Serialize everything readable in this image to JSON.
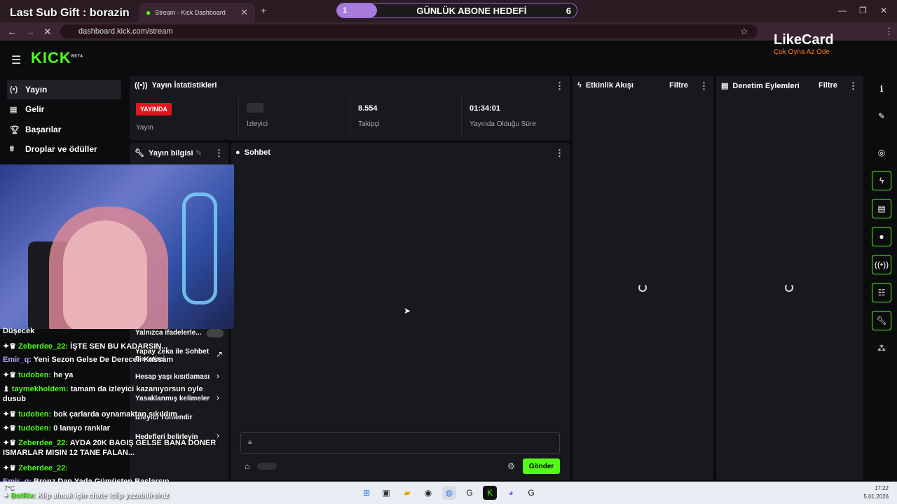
{
  "browser": {
    "tabs": [
      {
        "label": "Kick Dashboard",
        "title": "Stream - Kick Dashboard"
      }
    ],
    "url": "dashboard.kick.com/stream"
  },
  "overlay": {
    "last_sub_gift": "Last Sub Gift : borazin",
    "goal": {
      "current": "1",
      "label": "GÜNLÜK ABONE HEDEFİ",
      "target": "6",
      "progress": 0.1667
    },
    "likecard": {
      "name": "LikeCard",
      "tagline": "Çok Oyna  Az Öde"
    }
  },
  "header": {
    "logo": "KICK",
    "badge": "BETA"
  },
  "sidebar": {
    "items": [
      {
        "label": "Yayın",
        "icon": "broadcast-icon"
      },
      {
        "label": "Gelir",
        "icon": "revenue-icon"
      },
      {
        "label": "Başarılar",
        "icon": "trophy-icon"
      },
      {
        "label": "Droplar ve ödüller",
        "icon": "drops-icon"
      }
    ]
  },
  "stats": {
    "title": "Yayın İstatistikleri",
    "live_badge": "YAYINDA",
    "items": [
      {
        "value": "",
        "label": "Yayın"
      },
      {
        "value": "",
        "label": "İzleyici"
      },
      {
        "value": "8.554",
        "label": "Takipçi"
      },
      {
        "value": "01:34:01",
        "label": "Yayında Olduğu Süre"
      }
    ]
  },
  "panels": {
    "activity": {
      "title": "Etkinlik Akışı",
      "filter": "Filtre"
    },
    "moderation": {
      "title": "Denetim Eylemleri",
      "filter": "Filtre"
    },
    "stream_info": {
      "title": "Yayın bilgisi"
    },
    "chat": {
      "title": "Sohbet",
      "send": "Gönder"
    }
  },
  "settings_overlay": {
    "items": [
      "Yalnızca ifadelerle...",
      "Yapay Zeka ile Sohbet Denetimi",
      "Hesap yaşı kısıtlaması",
      "Yasaklanmış kelimeler",
      "İzleyici Yönlendir",
      "Hedefleri belirleyin"
    ]
  },
  "chat_overlay": {
    "lines": [
      {
        "user": "",
        "text": "Düşecek"
      },
      {
        "user": "Zeberdee_22:",
        "text": "İŞTE SEN BU KADARSIN..."
      },
      {
        "user": "Emir_q:",
        "text": "Yeni Sezon Gelse De Dereceli Kassam"
      },
      {
        "user": "tudoben:",
        "text": "he ya"
      },
      {
        "user": "taymekholdem:",
        "text": "tamam da izleyici kazanıyorsun oyle"
      },
      {
        "user": "",
        "text": "dusub"
      },
      {
        "user": "tudoben:",
        "text": "bok çarlarda oynamaktan sıkıldım"
      },
      {
        "user": "tudoben:",
        "text": "0 lanıyo ranklar"
      },
      {
        "user": "Zeberdee_22:",
        "text": "AYDA 20K BAGIŞ GELSE BANA DONER"
      },
      {
        "user": "",
        "text": "ISMARLAR MISIN 12 TANE FALAN..."
      },
      {
        "user": "Zeberdee_22:",
        "text": ""
      },
      {
        "user": "Emir_q:",
        "text": "Bronz Dan Yada Gümüşten Başlarsın"
      }
    ],
    "bot": {
      "user": "BotRix:",
      "text": "Klip almak için chate !clip yazabilirsiniz"
    }
  },
  "taskbar": {
    "weather": "7°C",
    "time": "17:22",
    "date": "5.01.2026"
  }
}
